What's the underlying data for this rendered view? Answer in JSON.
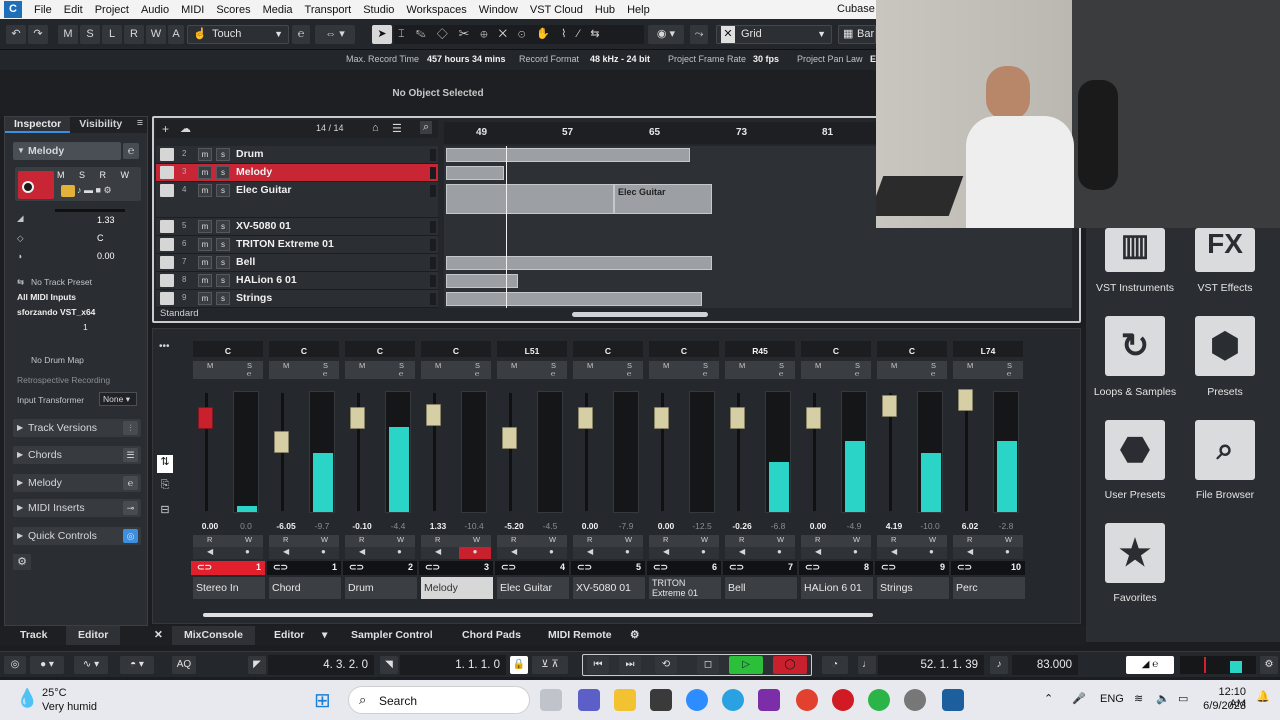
{
  "menu": {
    "items": [
      "File",
      "Edit",
      "Project",
      "Audio",
      "MIDI",
      "Scores",
      "Media",
      "Transport",
      "Studio",
      "Workspaces",
      "Window",
      "VST Cloud",
      "Hub",
      "Help"
    ],
    "app_title": "Cubase P"
  },
  "toolbar": {
    "mode_buttons": [
      "M",
      "S",
      "L",
      "R",
      "W",
      "A"
    ],
    "automation_mode": "Touch",
    "snap_type": "Grid",
    "quantize_label": "Bar"
  },
  "info_line": {
    "max_record_time_label": "Max. Record Time",
    "max_record_time_value": "457 hours 34 mins",
    "record_format_label": "Record Format",
    "record_format_value": "48 kHz - 24 bit",
    "frame_rate_label": "Project Frame Rate",
    "frame_rate_value": "30 fps",
    "pan_law_label": "Project Pan Law",
    "pan_law_value": "E"
  },
  "status": {
    "no_object": "No Object Selected"
  },
  "inspector": {
    "tab_inspector": "Inspector",
    "tab_visibility": "Visibility",
    "track_name": "Melody",
    "volume": "1.33",
    "pan": "0.00",
    "pan_center": "C",
    "no_track_preset": "No Track Preset",
    "input": "All MIDI Inputs",
    "output": "sforzando VST_x64",
    "channel": "1",
    "no_drum_map": "No Drum Map",
    "retro_record": "Retrospective Recording",
    "input_transformer": "Input Transformer",
    "input_transformer_value": "None",
    "sections": [
      "Track Versions",
      "Chords",
      "Melody",
      "MIDI Inserts",
      "Quick Controls"
    ]
  },
  "project": {
    "track_count": "14 / 14",
    "ruler_marks": [
      "49",
      "57",
      "65",
      "73",
      "81"
    ],
    "tracks": [
      {
        "num": "2",
        "name": "Drum"
      },
      {
        "num": "3",
        "name": "Melody"
      },
      {
        "num": "4",
        "name": "Elec Guitar"
      },
      {
        "num": "5",
        "name": "XV-5080 01"
      },
      {
        "num": "6",
        "name": "TRITON Extreme 01"
      },
      {
        "num": "7",
        "name": "Bell"
      },
      {
        "num": "8",
        "name": "HALion 6 01"
      },
      {
        "num": "9",
        "name": "Strings"
      }
    ],
    "part_label": "Elec Guitar",
    "zoom_preset": "Standard"
  },
  "mixer": {
    "channels": [
      {
        "num": "1",
        "name": "Stereo In",
        "pan": "C",
        "vol": "0.00",
        "peak": "0.0",
        "level": 0.05,
        "fader": 0.18
      },
      {
        "num": "1",
        "name": "Chord",
        "pan": "C",
        "vol": "-6.05",
        "peak": "-9.7",
        "level": 0.5,
        "fader": 0.42
      },
      {
        "num": "2",
        "name": "Drum",
        "pan": "C",
        "vol": "-0.10",
        "peak": "-4.4",
        "level": 0.72,
        "fader": 0.18
      },
      {
        "num": "3",
        "name": "Melody",
        "pan": "C",
        "vol": "1.33",
        "peak": "-10.4",
        "level": 0.0,
        "fader": 0.15
      },
      {
        "num": "4",
        "name": "Elec Guitar",
        "pan": "L51",
        "vol": "-5.20",
        "peak": "-4.5",
        "level": 0.0,
        "fader": 0.38
      },
      {
        "num": "5",
        "name": "XV-5080 01",
        "pan": "C",
        "vol": "0.00",
        "peak": "-7.9",
        "level": 0.0,
        "fader": 0.18
      },
      {
        "num": "6",
        "name": "TRITON Extreme 01",
        "pan": "C",
        "vol": "0.00",
        "peak": "-12.5",
        "level": 0.0,
        "fader": 0.18
      },
      {
        "num": "7",
        "name": "Bell",
        "pan": "R45",
        "vol": "-0.26",
        "peak": "-6.8",
        "level": 0.42,
        "fader": 0.18
      },
      {
        "num": "8",
        "name": "HALion 6 01",
        "pan": "C",
        "vol": "0.00",
        "peak": "-4.9",
        "level": 0.6,
        "fader": 0.18
      },
      {
        "num": "9",
        "name": "Strings",
        "pan": "C",
        "vol": "4.19",
        "peak": "-10.0",
        "level": 0.5,
        "fader": 0.06
      },
      {
        "num": "10",
        "name": "Perc",
        "pan": "L74",
        "vol": "6.02",
        "peak": "-2.8",
        "level": 0.6,
        "fader": 0.0
      }
    ]
  },
  "right_panel": {
    "tiles": [
      "VST Instruments",
      "VST Effects",
      "Loops & Samples",
      "Presets",
      "User Presets",
      "File Browser",
      "Favorites"
    ]
  },
  "lower_tabs": {
    "left": [
      "Track",
      "Editor"
    ],
    "right": [
      "MixConsole",
      "Editor",
      "Sampler Control",
      "Chord Pads",
      "MIDI Remote"
    ]
  },
  "transport": {
    "left_locator": "4. 3. 2.   0",
    "right_locator": "1. 1. 1.   0",
    "position": "52. 1. 1. 39",
    "tempo": "83.000",
    "aq": "AQ"
  },
  "taskbar": {
    "temp": "25°C",
    "weather": "Very humid",
    "search": "Search",
    "lang": "ENG",
    "time": "12:10 AM",
    "date": "6/9/2023"
  },
  "colors": {
    "accent": "#c82535",
    "meter": "#2ad4c6",
    "play": "#2bbf3a",
    "record": "#c8202c"
  }
}
